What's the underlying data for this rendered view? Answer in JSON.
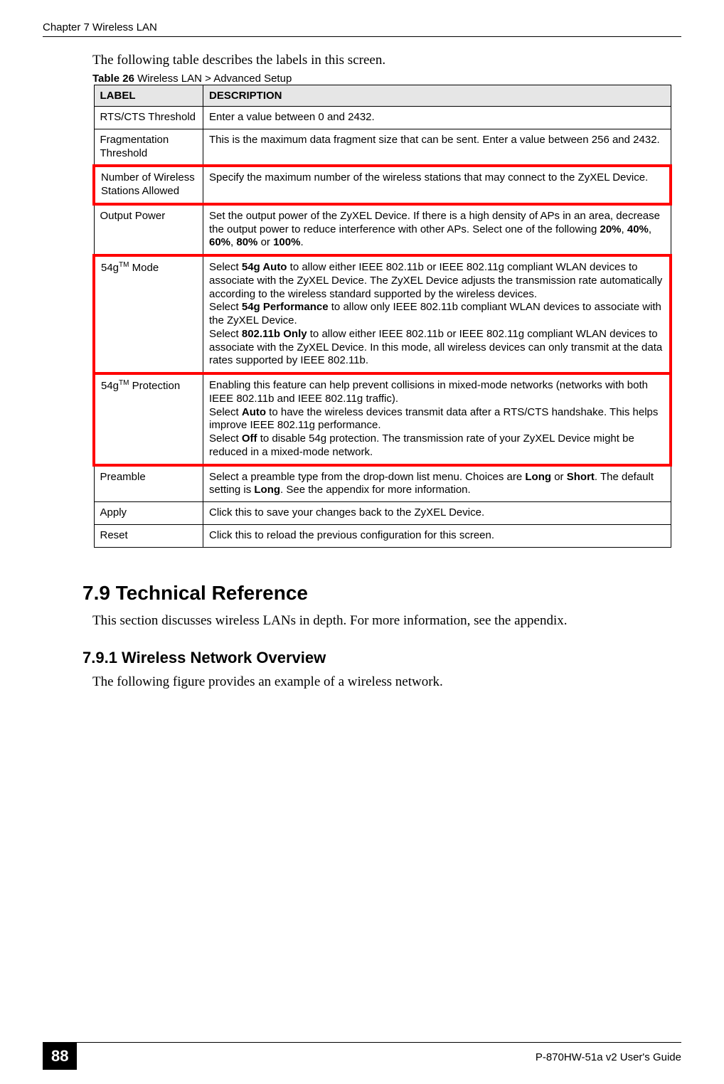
{
  "header": {
    "chapter": "Chapter 7 Wireless LAN"
  },
  "intro": "The following table describes the labels in this screen.",
  "table_caption": {
    "prefix": "Table 26",
    "title": "   Wireless LAN > Advanced Setup"
  },
  "table_headers": {
    "label": "LABEL",
    "description": "DESCRIPTION"
  },
  "rows": [
    {
      "label": "RTS/CTS Threshold",
      "desc_html": "Enter a value between 0 and 2432.",
      "red": false
    },
    {
      "label": "Fragmentation Threshold",
      "desc_html": "This is the maximum data fragment size that can be sent. Enter a value between 256 and 2432.",
      "red": false
    },
    {
      "label": "Number of Wireless Stations Allowed",
      "desc_html": "Specify the maximum number of the wireless stations that may connect to the ZyXEL Device.",
      "red": true
    },
    {
      "label": "Output Power",
      "desc_html": "Set the output power of the ZyXEL Device. If there is a high density of APs in an area, decrease the output power to reduce interference with other APs. Select one of the following <span class=\"b\">20%</span>, <span class=\"b\">40%</span>, <span class=\"b\">60%</span>, <span class=\"b\">80%</span> or <span class=\"b\">100%</span>.",
      "red": false
    },
    {
      "label": "54g<span class=\"sup\">TM</span> Mode",
      "desc_html": "Select <span class=\"b\">54g Auto</span> to allow either IEEE 802.11b or IEEE 802.11g compliant WLAN devices to associate with the ZyXEL Device. The ZyXEL Device adjusts the transmission rate automatically according to the wireless standard supported by the wireless devices.<br>Select <span class=\"b\">54g Performance</span> to allow only IEEE 802.11b compliant WLAN devices to associate with the ZyXEL Device.<br>Select <span class=\"b\">802.11b Only</span> to allow either IEEE 802.11b or IEEE 802.11g compliant WLAN devices to associate with the ZyXEL Device. In this mode, all wireless devices can only transmit at the data rates supported by IEEE 802.11b.",
      "red": true
    },
    {
      "label": "54g<span class=\"sup\">TM</span> Protection",
      "desc_html": "Enabling this feature can help prevent collisions in mixed-mode networks (networks with both IEEE 802.11b and IEEE 802.11g traffic).<br>Select <span class=\"b\">Auto</span> to have the wireless devices transmit data after a RTS/CTS handshake. This helps improve IEEE 802.11g performance.<br>Select <span class=\"b\">Off</span> to disable 54g protection. The transmission rate of your ZyXEL Device might be reduced in a mixed-mode network.",
      "red": true
    },
    {
      "label": "Preamble",
      "desc_html": "Select a preamble type from the drop-down list menu. Choices are <span class=\"b\">Long</span> or <span class=\"b\">Short</span>. The default setting is <span class=\"b\">Long</span>. See the appendix for more information.",
      "red": false
    },
    {
      "label": "Apply",
      "desc_html": "Click this to save your changes back to the ZyXEL Device.",
      "red": false
    },
    {
      "label": "Reset",
      "desc_html": "Click this to reload the previous configuration for this screen.",
      "red": false
    }
  ],
  "section79": {
    "heading": "7.9  Technical Reference",
    "body": "This section discusses wireless LANs in depth. For more information, see the appendix."
  },
  "section791": {
    "heading": "7.9.1  Wireless Network Overview",
    "body": "The following figure provides an example of a wireless network."
  },
  "footer": {
    "page": "88",
    "guide": "P-870HW-51a v2 User's Guide"
  }
}
